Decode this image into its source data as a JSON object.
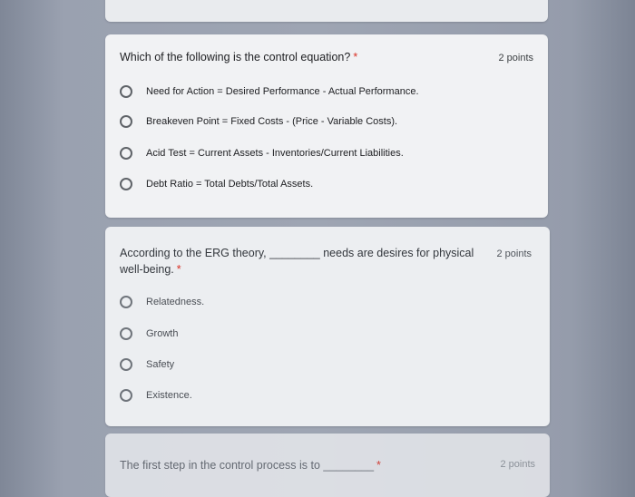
{
  "questions": [
    {
      "title": "Which of the following is the control equation?",
      "required_mark": "*",
      "points": "2 points",
      "options": [
        "Need for Action = Desired Performance - Actual Performance.",
        "Breakeven Point = Fixed Costs - (Price - Variable Costs).",
        "Acid Test = Current Assets - Inventories/Current Liabilities.",
        "Debt Ratio = Total Debts/Total Assets."
      ]
    },
    {
      "title": "According to the ERG theory, ________ needs are desires for physical well-being.",
      "required_mark": "*",
      "points": "2 points",
      "options": [
        "Relatedness.",
        "Growth",
        "Safety",
        "Existence."
      ]
    },
    {
      "title": "The first step in the control process is to ________",
      "required_mark": "*",
      "points": "2 points"
    }
  ]
}
